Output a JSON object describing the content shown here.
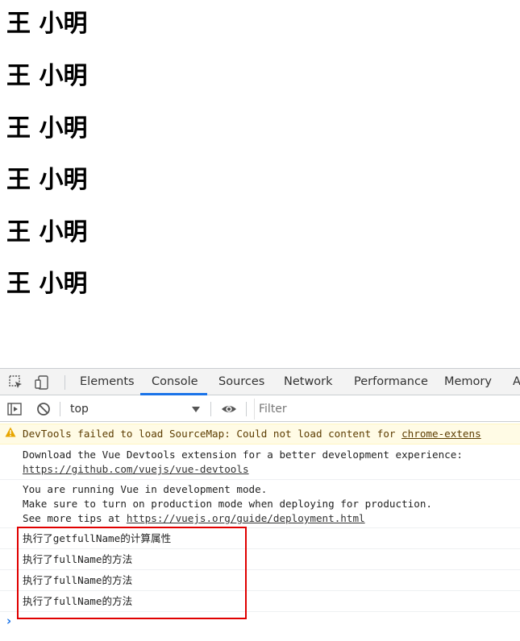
{
  "page": {
    "headings": [
      "王 小明",
      "王 小明",
      "王 小明",
      "王 小明",
      "王 小明",
      "王 小明"
    ]
  },
  "devtools": {
    "tabs": [
      "Elements",
      "Console",
      "Sources",
      "Network",
      "Performance",
      "Memory",
      "A"
    ],
    "active_tab": "Console",
    "context": "top",
    "filter_placeholder": "Filter",
    "messages": {
      "warning": {
        "text": "DevTools failed to load SourceMap: Could not load content for ",
        "link": "chrome-extens"
      },
      "vue_devtools": {
        "line1": "Download the Vue Devtools extension for a better development experience:",
        "link": "https://github.com/vuejs/vue-devtools"
      },
      "vue_mode": {
        "line1": "You are running Vue in development mode.",
        "line2": "Make sure to turn on production mode when deploying for production.",
        "line3_prefix": "See more tips at ",
        "line3_link": "https://vuejs.org/guide/deployment.html"
      },
      "logs": [
        {
          "pre": "执行了",
          "code": "getfullName",
          "post": "的计算属性"
        },
        {
          "pre": "执行了",
          "code": "fullName",
          "post": "的方法"
        },
        {
          "pre": "执行了",
          "code": "fullName",
          "post": "的方法"
        },
        {
          "pre": "执行了",
          "code": "fullName",
          "post": "的方法"
        }
      ]
    },
    "colors": {
      "accent": "#1a73e8",
      "highlight_box": "#e00000",
      "warning_bg": "#fffbe5"
    }
  }
}
